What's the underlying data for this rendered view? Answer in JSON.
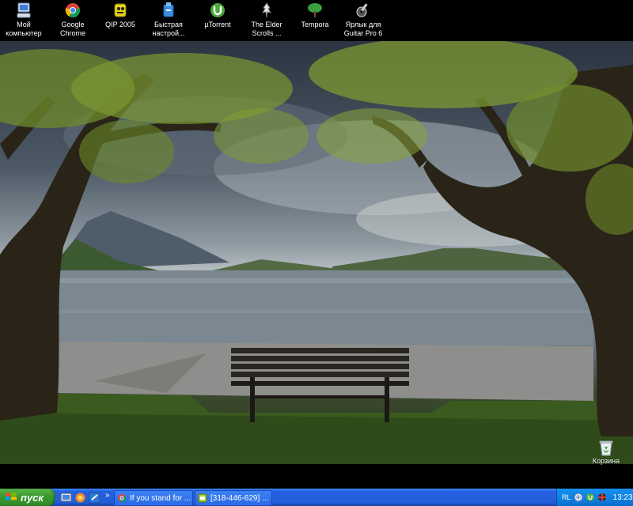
{
  "desktop_icons": [
    {
      "id": "my-computer",
      "label": "Мой\nкомпьютер",
      "icon": "computer-icon"
    },
    {
      "id": "google-chrome",
      "label": "Google\nChrome",
      "icon": "chrome-icon"
    },
    {
      "id": "qip-2005",
      "label": "QIP 2005",
      "icon": "qip-icon"
    },
    {
      "id": "quick-setup",
      "label": "Быстрая\nнастрой...",
      "icon": "setup-icon"
    },
    {
      "id": "utorrent",
      "label": "µTorrent",
      "icon": "utorrent-icon"
    },
    {
      "id": "elder-scrolls",
      "label": "The Elder\nScrolls ...",
      "icon": "elder-scrolls-icon"
    },
    {
      "id": "tempora",
      "label": "Tempora",
      "icon": "tree-icon"
    },
    {
      "id": "guitar-pro",
      "label": "Ярлык для\nGuitar Pro 6",
      "icon": "guitar-icon"
    }
  ],
  "recycle_bin": {
    "label": "Корзина",
    "icon": "recycle-bin-icon"
  },
  "taskbar": {
    "start_label": "пуск",
    "quick_launch": [
      "desktop-icon",
      "browser-icon",
      "ie-icon"
    ],
    "chevron": "»",
    "buttons": [
      {
        "label": "If you stand for ...",
        "icon": "chrome-icon"
      },
      {
        "label": "[318-446-629] ...",
        "icon": "qip-icon"
      }
    ],
    "tray": {
      "language": "RL",
      "clock": "13:23"
    }
  },
  "colors": {
    "taskbar": "#225dd8",
    "start": "#3c9a32",
    "tray": "#0f7fe0"
  }
}
